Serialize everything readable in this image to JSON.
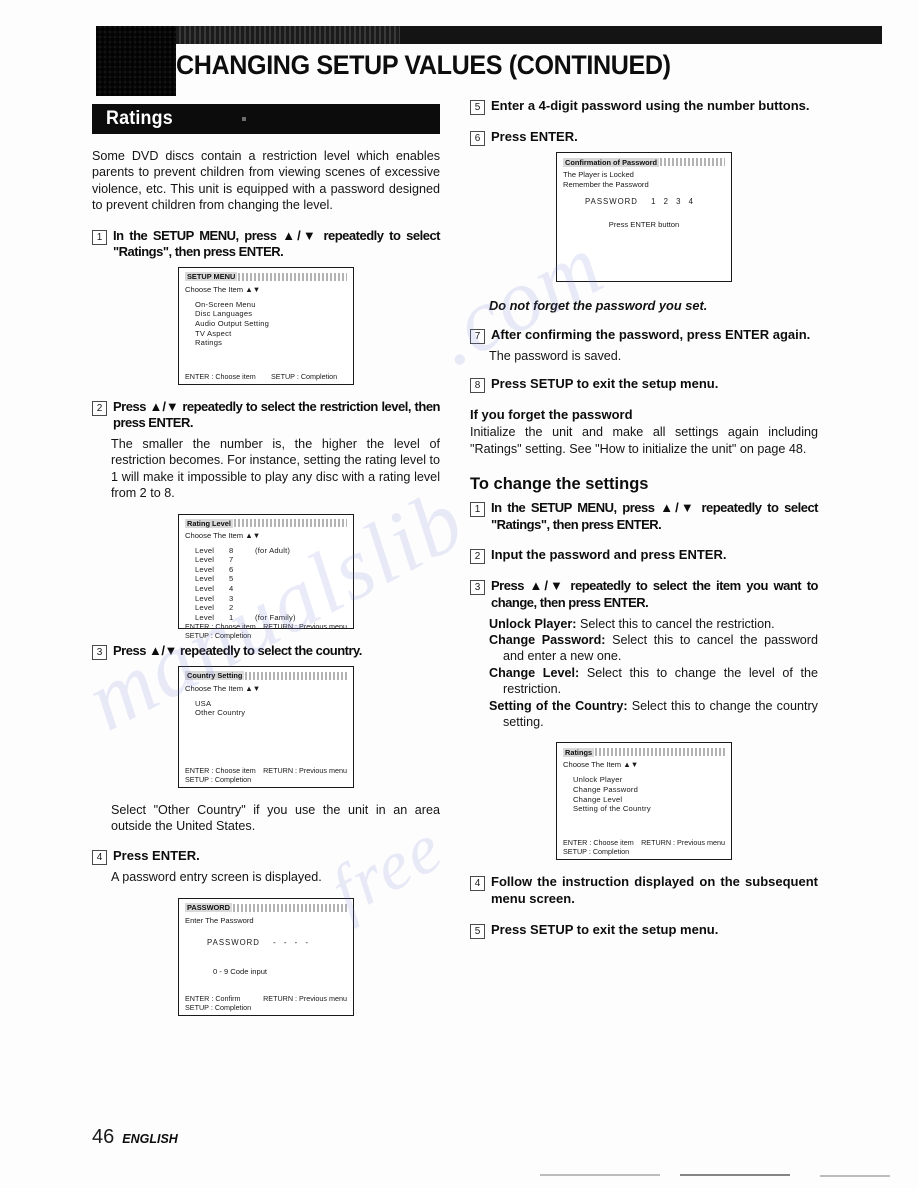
{
  "header": {
    "title": "CHANGING SETUP VALUES (CONTINUED)"
  },
  "watermark": {
    "line1": "manualslib",
    "line2": ".com",
    "line3": "free"
  },
  "footer": {
    "page_number": "46",
    "language": "ENGLISH"
  },
  "left_column": {
    "banner_title": "Ratings",
    "intro": "Some DVD discs contain a restriction level which enables parents to prevent children from viewing scenes of excessive violence, etc. This unit is equipped with a password designed to prevent children from changing the level.",
    "step1": {
      "num": "1",
      "text": "In the SETUP MENU, press ▲/▼ repeatedly to select \"Ratings\", then press ENTER."
    },
    "setup_menu_screen": {
      "title": "SETUP MENU",
      "choose": "Choose The Item ▲▼",
      "items": [
        "On-Screen Menu",
        "Disc Languages",
        "Audio Output Setting",
        "TV Aspect",
        "Ratings"
      ],
      "footer_left": "ENTER : Choose item",
      "footer_right": "SETUP : Completion"
    },
    "step2": {
      "num": "2",
      "text": "Press ▲/▼ repeatedly to select the restriction level, then press ENTER.",
      "body": "The smaller the number is, the higher the level of restriction becomes. For instance, setting the rating level to 1 will make it impossible to play any disc with a rating level from 2 to 8."
    },
    "rating_level_screen": {
      "title": "Rating Level",
      "choose": "Choose The Item ▲▼",
      "rows": [
        {
          "label": "Level",
          "value": "8",
          "note": "(for Adult)"
        },
        {
          "label": "Level",
          "value": "7",
          "note": ""
        },
        {
          "label": "Level",
          "value": "6",
          "note": ""
        },
        {
          "label": "Level",
          "value": "5",
          "note": ""
        },
        {
          "label": "Level",
          "value": "4",
          "note": ""
        },
        {
          "label": "Level",
          "value": "3",
          "note": ""
        },
        {
          "label": "Level",
          "value": "2",
          "note": ""
        },
        {
          "label": "Level",
          "value": "1",
          "note": "(for Family)"
        }
      ],
      "footer_line1_left": "ENTER : Choose item",
      "footer_line1_right": "RETURN : Previous menu",
      "footer_line2": "SETUP : Completion"
    },
    "step3": {
      "num": "3",
      "text": "Press ▲/▼ repeatedly to select the country."
    },
    "country_screen": {
      "title": "Country Setting",
      "choose": "Choose The Item ▲▼",
      "items": [
        "USA",
        "Other Country"
      ],
      "footer_line1_left": "ENTER : Choose item",
      "footer_line1_right": "RETURN : Previous menu",
      "footer_line2": "SETUP : Completion"
    },
    "country_note": "Select \"Other Country\" if you use the unit in an area outside the United States.",
    "step4": {
      "num": "4",
      "text": "Press ENTER.",
      "body": "A password entry screen is displayed."
    },
    "password_screen": {
      "title": "PASSWORD",
      "choose": "Enter The Password",
      "password_label": "PASSWORD",
      "password_value": "- - - -",
      "code_input": "0 - 9   Code input",
      "footer_line1_left": "ENTER : Confirm",
      "footer_line1_right": "RETURN : Previous menu",
      "footer_line2": "SETUP : Completion"
    }
  },
  "right_column": {
    "step5": {
      "num": "5",
      "text": "Enter a 4-digit password using the number buttons."
    },
    "step6": {
      "num": "6",
      "text": "Press ENTER."
    },
    "confirmation_screen": {
      "title": "Confirmation of Password",
      "line1": "The Player is Locked",
      "line2": "Remember the Password",
      "password_label": "PASSWORD",
      "password_value": "1 2 3 4",
      "prompt": "Press ENTER button"
    },
    "do_not_forget": "Do not forget the password you set.",
    "step7": {
      "num": "7",
      "text": "After confirming the password, press ENTER again.",
      "body": "The password is saved."
    },
    "step8": {
      "num": "8",
      "text": "Press SETUP to exit the setup menu."
    },
    "forget_heading": "If you forget the password",
    "forget_body": "Initialize the unit and make all settings again  including \"Ratings\" setting.  See \"How to initialize the unit\" on page 48.",
    "change_heading": "To change the settings",
    "change_step1": {
      "num": "1",
      "text": "In the SETUP MENU, press ▲/▼ repeatedly to select \"Ratings\", then press ENTER."
    },
    "change_step2": {
      "num": "2",
      "text": "Input the password and press ENTER."
    },
    "change_step3": {
      "num": "3",
      "text": "Press ▲/▼ repeatedly to select the item you want to change, then press ENTER.",
      "definitions": [
        {
          "term": "Unlock Player:",
          "desc": " Select this to cancel the restriction."
        },
        {
          "term": "Change Password:",
          "desc": " Select this to cancel the password and enter a new one."
        },
        {
          "term": "Change Level:",
          "desc": " Select this to change the level of the restriction."
        },
        {
          "term": "Setting of the Country:",
          "desc": " Select this to change the country setting."
        }
      ]
    },
    "ratings_menu_screen": {
      "title": "Ratings",
      "choose": "Choose The Item ▲▼",
      "items": [
        "Unlock Player",
        "Change Password",
        "Change Level",
        "Setting of the Country"
      ],
      "footer_line1_left": "ENTER : Choose item",
      "footer_line1_right": "RETURN : Previous menu",
      "footer_line2": "SETUP : Completion"
    },
    "change_step4": {
      "num": "4",
      "text": "Follow the instruction displayed on the subsequent menu screen."
    },
    "change_step5": {
      "num": "5",
      "text": "Press SETUP to exit the setup menu."
    }
  }
}
